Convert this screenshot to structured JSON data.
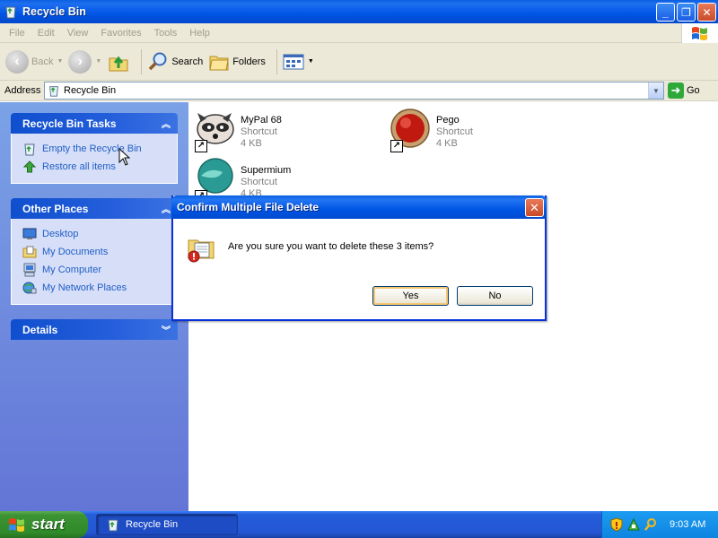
{
  "window": {
    "title": "Recycle Bin",
    "buttons": {
      "minimize": "_",
      "maximize": "❐",
      "close": "✕"
    }
  },
  "menu": [
    "File",
    "Edit",
    "View",
    "Favorites",
    "Tools",
    "Help"
  ],
  "toolbar": {
    "back": "Back",
    "search": "Search",
    "folders": "Folders"
  },
  "address": {
    "label": "Address",
    "value": "Recycle Bin",
    "go": "Go"
  },
  "taskpane": {
    "tasks": {
      "title": "Recycle Bin Tasks",
      "items": [
        "Empty the Recycle Bin",
        "Restore all items"
      ]
    },
    "places": {
      "title": "Other Places",
      "items": [
        "Desktop",
        "My Documents",
        "My Computer",
        "My Network Places"
      ]
    },
    "details": {
      "title": "Details"
    }
  },
  "files": [
    {
      "name": "MyPal 68",
      "type": "Shortcut",
      "size": "4 KB"
    },
    {
      "name": "Pego",
      "type": "Shortcut",
      "size": "4 KB"
    },
    {
      "name": "Supermium",
      "type": "Shortcut",
      "size": "4 KB"
    }
  ],
  "dialog": {
    "title": "Confirm Multiple File Delete",
    "message": "Are you sure you want to delete these 3 items?",
    "yes": "Yes",
    "no": "No"
  },
  "taskbar": {
    "start": "start",
    "task": "Recycle Bin",
    "clock": "9:03 AM"
  },
  "colors": {
    "titlebar": "#0055e5",
    "taskpane_link": "#215dc6",
    "start_green": "#308a2a"
  }
}
